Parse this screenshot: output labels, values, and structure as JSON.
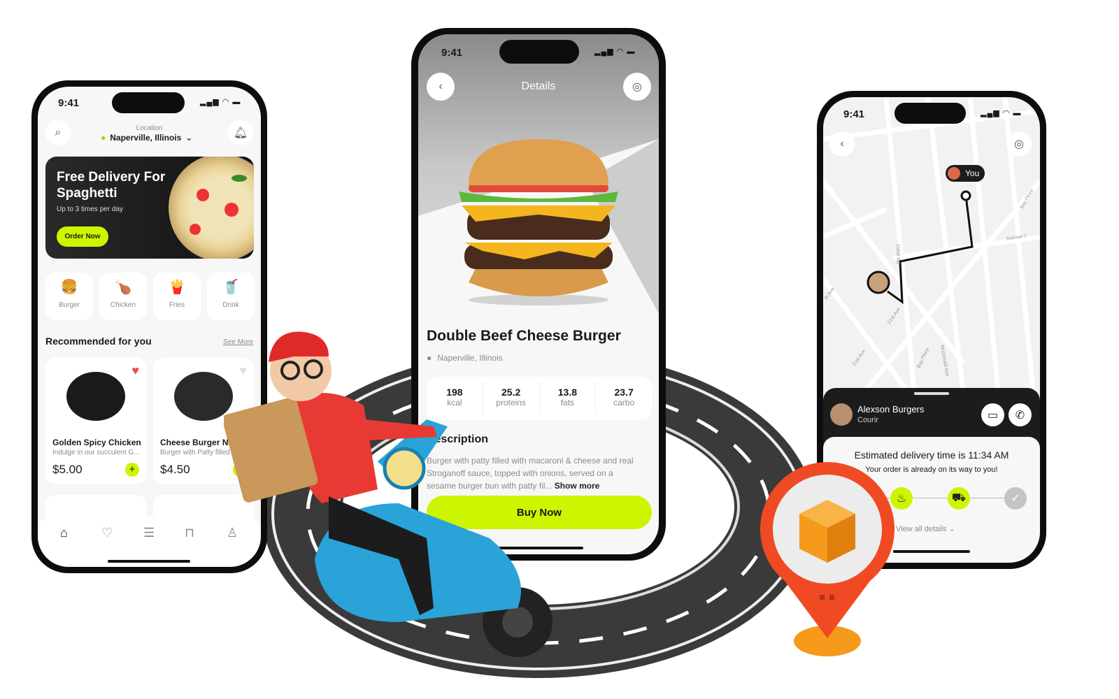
{
  "colors": {
    "accent": "#ccf500",
    "dark": "#1c1c1c",
    "pin_red": "#f04a24",
    "box_orange": "#f59a1a",
    "heart_red": "#e84d4d"
  },
  "status": {
    "time": "9:41"
  },
  "home": {
    "location_label": "Location",
    "location": "Naperville, Illinois",
    "banner": {
      "title": "Free Delivery For Spaghetti",
      "subtitle": "Up to 3 times per day",
      "button": "Order Now"
    },
    "categories": [
      {
        "label": "Burger",
        "icon": "🍔"
      },
      {
        "label": "Chicken",
        "icon": "🍗"
      },
      {
        "label": "Fries",
        "icon": "🍟"
      },
      {
        "label": "Drink",
        "icon": "🥤"
      }
    ],
    "section_title": "Recommended for you",
    "see_more": "See More",
    "products": [
      {
        "name": "Golden Spicy Chicken",
        "desc": "Indulge in our succulent G...",
        "price": "$5.00",
        "favorite": true
      },
      {
        "name": "Cheese Burger Nag",
        "desc": "Burger with Patty filled w",
        "price": "$4.50",
        "favorite": false
      }
    ],
    "nav": [
      "home",
      "favorites",
      "orders",
      "bag",
      "profile"
    ]
  },
  "details": {
    "title": "Details",
    "name": "Double Beef Cheese Burger",
    "location": "Naperville, Illinois",
    "nutrition": [
      {
        "value": "198",
        "unit": "kcal"
      },
      {
        "value": "25.2",
        "unit": "proteins"
      },
      {
        "value": "13.8",
        "unit": "fats"
      },
      {
        "value": "23.7",
        "unit": "carbo"
      }
    ],
    "desc_title": "Description",
    "desc_lines": [
      "Burger with patty filled with macaroni & cheese and real",
      "Stroganoff sauce, topped with onions, served on a",
      "sesame burger bun with patty fil..."
    ],
    "show_more": "Show more",
    "buy": "Buy Now"
  },
  "tracking": {
    "you": "You",
    "streets": [
      "Dahill Rd",
      "21st Ave",
      "21st Ave",
      "Bay Pkwy",
      "McDonald Ave",
      "Avenue J",
      "Bay Pkwy",
      "th Ave"
    ],
    "courier_name": "Alexson Burgers",
    "courier_role": "Courir",
    "eta": "Estimated delivery time is 11:34 AM",
    "eta_sub": "Your order is already on its way to you!",
    "steps": [
      {
        "icon": "cooking-pot",
        "done": true
      },
      {
        "icon": "truck",
        "done": true
      },
      {
        "icon": "check",
        "done": false
      }
    ],
    "view_all": "View all details"
  }
}
